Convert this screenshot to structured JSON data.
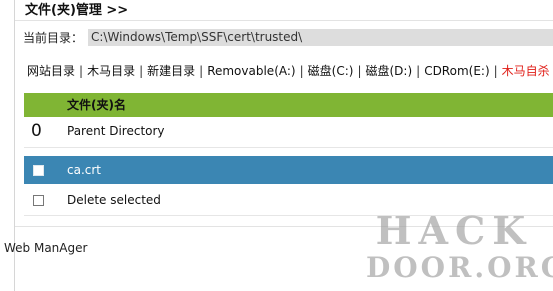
{
  "header": {
    "title": "文件(夹)管理 >>"
  },
  "path": {
    "label": "当前目录：",
    "value": "C:\\Windows\\Temp\\SSF\\cert\\trusted\\"
  },
  "nav": {
    "items": [
      {
        "label": "网站目录",
        "danger": false
      },
      {
        "label": "木马目录",
        "danger": false
      },
      {
        "label": "新建目录",
        "danger": false
      },
      {
        "label": "Removable(A:)",
        "danger": false
      },
      {
        "label": "磁盘(C:)",
        "danger": false
      },
      {
        "label": "磁盘(D:)",
        "danger": false
      },
      {
        "label": "CDRom(E:)",
        "danger": false
      },
      {
        "label": "木马自杀",
        "danger": true
      }
    ],
    "separator": "|"
  },
  "table": {
    "header": "文件(夹)名",
    "parent": {
      "num": "0",
      "label": "Parent Directory"
    },
    "file": {
      "name": "ca.crt",
      "checked": false
    },
    "delete": {
      "label": "Delete selected",
      "checked": false
    }
  },
  "footer": {
    "text": "Web ManAger"
  },
  "watermark": {
    "line1": "HACK",
    "line2": "DOOR.ORG"
  },
  "colors": {
    "header_green": "#80b534",
    "selected_blue": "#3b86b3",
    "danger_red": "#e0201a"
  }
}
